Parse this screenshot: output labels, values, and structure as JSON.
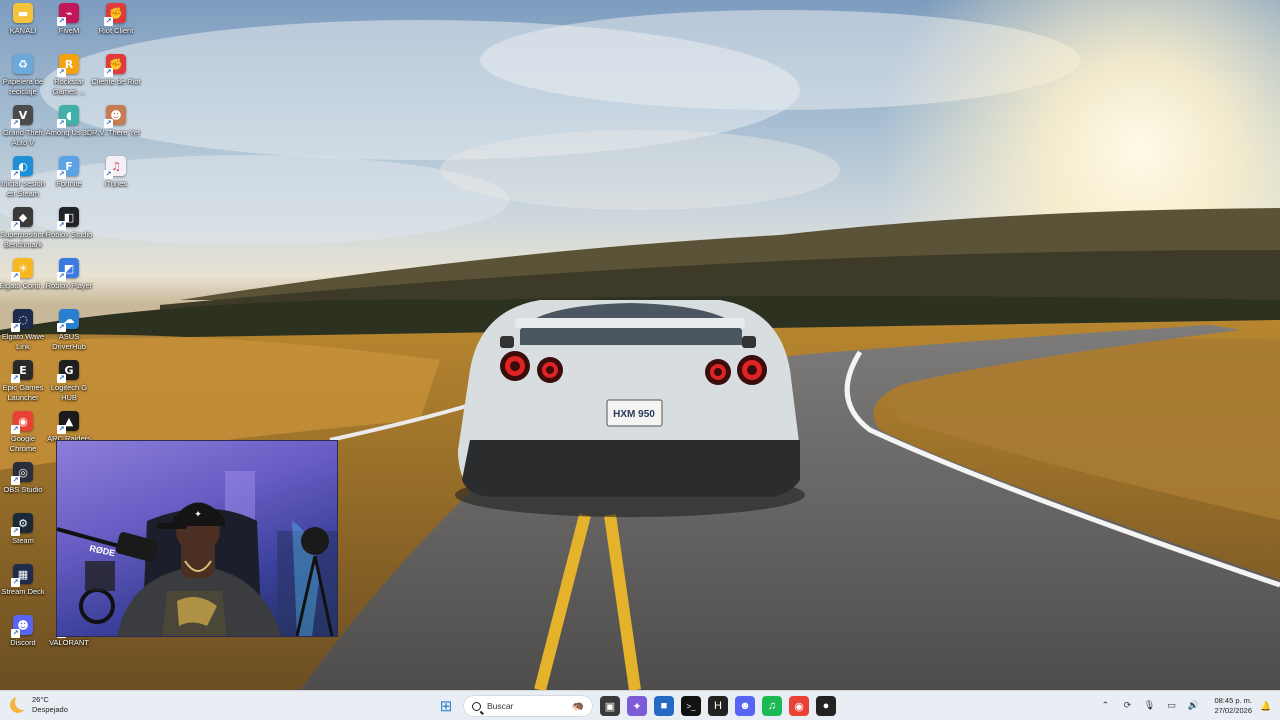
{
  "desktop": {
    "icons": [
      {
        "label": "KANALI",
        "icon": "folder-icon",
        "color": "#f3c33c"
      },
      {
        "label": "FiveM",
        "icon": "fivem-icon",
        "color": "#c2185b"
      },
      {
        "label": "Riot Client",
        "icon": "riot-client-icon",
        "color": "#e03a3e"
      },
      {
        "label": "Papelera de reciclaje",
        "icon": "recycle-bin-icon",
        "color": "#6aa9d9"
      },
      {
        "label": "Rockstar Games ...",
        "icon": "rockstar-icon",
        "color": "#f2a30f"
      },
      {
        "label": "Cliente de Riot",
        "icon": "riot-client-icon",
        "color": "#e03a3e"
      },
      {
        "label": "Grand Theft Auto V",
        "icon": "gta-v-icon",
        "color": "#4b4b4b"
      },
      {
        "label": "Among Us 3D",
        "icon": "among-us-icon",
        "color": "#3fb1a8"
      },
      {
        "label": "R.V. There Yet",
        "icon": "rv-there-yet-icon",
        "color": "#c77b53"
      },
      {
        "label": "Iniciar sesión en Steam",
        "icon": "edge-steam-icon",
        "color": "#1d8fd6"
      },
      {
        "label": "Fortnite",
        "icon": "fortnite-icon",
        "color": "#5aa3e6"
      },
      {
        "label": "iTunes",
        "icon": "itunes-icon",
        "color": "#f4f0f6"
      },
      {
        "label": "Superposition Benchmark",
        "icon": "superposition-icon",
        "color": "#3a3a3a"
      },
      {
        "label": "Roblox Studio",
        "icon": "roblox-studio-icon",
        "color": "#202225"
      },
      {
        "label": "Elgato Contr...",
        "icon": "elgato-control-icon",
        "color": "#f5b820"
      },
      {
        "label": "Roblox Player",
        "icon": "roblox-player-icon",
        "color": "#3b7ae0"
      },
      {
        "label": "Elgato Wave Link",
        "icon": "wave-link-icon",
        "color": "#1d2b4f"
      },
      {
        "label": "ASUS DriverHub",
        "icon": "asus-driverhub-icon",
        "color": "#2b7fd0"
      },
      {
        "label": "Epic Games Launcher",
        "icon": "epic-games-icon",
        "color": "#2a2a2a"
      },
      {
        "label": "Logitech G HUB",
        "icon": "logitech-ghub-icon",
        "color": "#1f1f1f"
      },
      {
        "label": "Google Chrome",
        "icon": "chrome-icon",
        "color": "#e94235"
      },
      {
        "label": "ARC Raiders",
        "icon": "arc-raiders-icon",
        "color": "#1b1b1b"
      },
      {
        "label": "OBS Studio",
        "icon": "obs-studio-icon",
        "color": "#2b2e3a"
      },
      {
        "label": "Steam",
        "icon": "steam-icon",
        "color": "#1b2838"
      },
      {
        "label": "Stream Deck",
        "icon": "stream-deck-icon",
        "color": "#1e2b4d"
      },
      {
        "label": "Discord",
        "icon": "discord-icon",
        "color": "#5865f2"
      },
      {
        "label": "VALORANT",
        "icon": "valorant-icon",
        "color": "#ff4655"
      }
    ]
  },
  "webcam": {
    "mic_brand": "RØDE"
  },
  "taskbar": {
    "weather": {
      "temp": "26°C",
      "condition": "Despejado"
    },
    "search_placeholder": "Buscar",
    "apps": [
      {
        "name": "start-button",
        "glyph": "⊞",
        "color": "#2b7fd0"
      },
      {
        "name": "task-view-button",
        "glyph": "▣",
        "color": "#3a3a3a"
      },
      {
        "name": "copilot-button",
        "glyph": "✦",
        "color": "#7b5cd6"
      },
      {
        "name": "microsoft-store-button",
        "glyph": "■",
        "color": "#2469c4"
      },
      {
        "name": "terminal-button",
        "glyph": ">_",
        "color": "#111111"
      },
      {
        "name": "hhs-app-button",
        "glyph": "H",
        "color": "#222222"
      },
      {
        "name": "discord-taskbar-button",
        "glyph": "☻",
        "color": "#5865f2"
      },
      {
        "name": "spotify-taskbar-button",
        "glyph": "♫",
        "color": "#1db954"
      },
      {
        "name": "chrome-taskbar-button",
        "glyph": "◉",
        "color": "#e94235"
      },
      {
        "name": "obs-taskbar-button",
        "glyph": "●",
        "color": "#222222"
      }
    ],
    "tray": {
      "time": "08:45 p. m.",
      "date": "27/02/2026"
    }
  }
}
